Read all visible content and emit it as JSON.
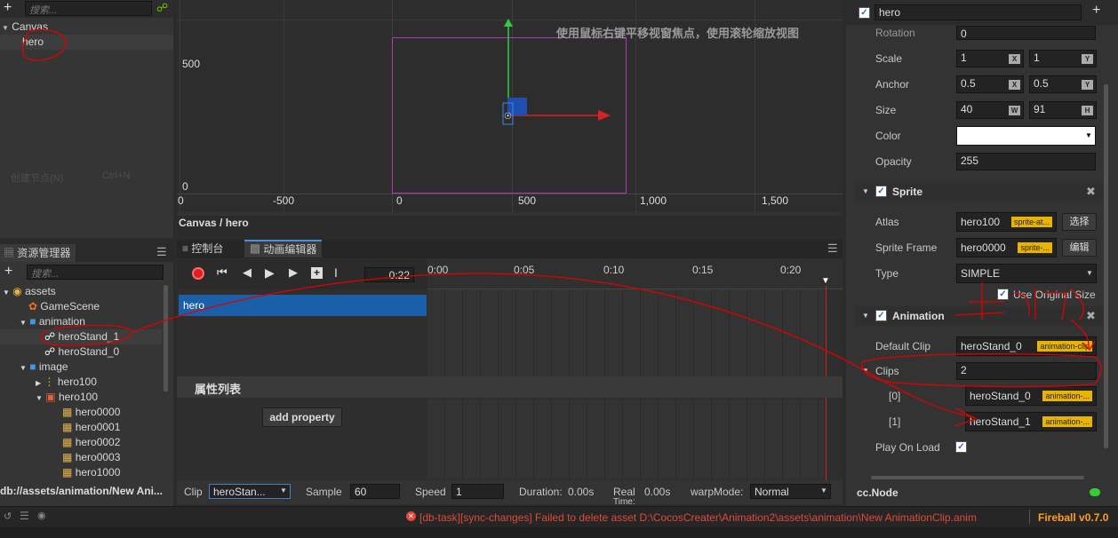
{
  "hierarchy": {
    "search_placeholder": "搜索...",
    "root": "Canvas",
    "child": "hero",
    "faded_menu_label": "创建节点(N)",
    "faded_menu_shortcut": "Ctrl+N"
  },
  "scene": {
    "hint": "使用鼠标右键平移视窗焦点，使用滚轮缩放视图",
    "y_ticks": [
      "500",
      "0"
    ],
    "x_ticks": [
      "0",
      "-500",
      "0",
      "500",
      "1,000",
      "1,500"
    ],
    "breadcrumb": "Canvas / hero"
  },
  "assets": {
    "tab_label": "资源管理器",
    "search_placeholder": "搜索...",
    "items": [
      {
        "label": "assets",
        "icon": "folder-icon"
      },
      {
        "label": "GameScene",
        "icon": "scene-icon"
      },
      {
        "label": "animation",
        "icon": "folder-icon"
      },
      {
        "label": "heroStand_1",
        "icon": "animation-clip-icon"
      },
      {
        "label": "heroStand_0",
        "icon": "animation-clip-icon"
      },
      {
        "label": "image",
        "icon": "folder-icon"
      },
      {
        "label": "hero100",
        "icon": "atlas-icon"
      },
      {
        "label": "hero100",
        "icon": "texture-icon"
      },
      {
        "label": "hero0000",
        "icon": "sprite-frame-icon"
      },
      {
        "label": "hero0001",
        "icon": "sprite-frame-icon"
      },
      {
        "label": "hero0002",
        "icon": "sprite-frame-icon"
      },
      {
        "label": "hero0003",
        "icon": "sprite-frame-icon"
      },
      {
        "label": "hero1000",
        "icon": "sprite-frame-icon"
      }
    ],
    "path": "db://assets/animation/New Ani..."
  },
  "timeline": {
    "tab_console": "控制台",
    "tab_animation": "动画编辑器",
    "time_value": "0:22",
    "ruler": [
      "0:00",
      "0:05",
      "0:10",
      "0:15",
      "0:20"
    ],
    "node_row": "hero",
    "property_list_title": "属性列表",
    "add_property": "add property",
    "clip_label": "Clip",
    "clip_value": "heroStan...",
    "sample_label": "Sample",
    "sample_value": "60",
    "speed_label": "Speed",
    "speed_value": "1",
    "duration_label": "Duration:",
    "duration_value": "0.00s",
    "real_label": "Real",
    "real_sub": "Time:",
    "real_value": "0.00s",
    "warp_label": "warpMode:",
    "warp_value": "Normal"
  },
  "inspector": {
    "node_name": "hero",
    "rotation_label": "Rotation",
    "rotation_value": "0",
    "scale_label": "Scale",
    "scale_x": "1",
    "scale_y": "1",
    "anchor_label": "Anchor",
    "anchor_x": "0.5",
    "anchor_y": "0.5",
    "size_label": "Size",
    "size_w": "40",
    "size_h": "91",
    "color_label": "Color",
    "opacity_label": "Opacity",
    "opacity_value": "255",
    "sprite_title": "Sprite",
    "atlas_label": "Atlas",
    "atlas_value": "hero100",
    "atlas_badge": "sprite-at...",
    "select_btn": "选择",
    "frame_label": "Sprite Frame",
    "frame_value": "hero0000",
    "frame_badge": "sprite-...",
    "edit_btn": "编辑",
    "type_label": "Type",
    "type_value": "SIMPLE",
    "use_original": "Use Original Size",
    "animation_title": "Animation",
    "default_clip_label": "Default Clip",
    "default_clip_value": "heroStand_0",
    "default_clip_badge": "animation-clip",
    "clips_label": "Clips",
    "clips_value": "2",
    "clip0_index": "[0]",
    "clip0_value": "heroStand_0",
    "clip0_badge": "animation-...",
    "clip1_index": "[1]",
    "clip1_value": "heroStand_1",
    "clip1_badge": "animation-...",
    "play_on_load": "Play On Load",
    "component_type": "cc.Node",
    "axis_x": "X",
    "axis_y": "Y",
    "axis_w": "W",
    "axis_h": "H"
  },
  "status": {
    "error": "[db-task][sync-changes] Failed to delete asset D:\\CocosCreater\\Animation2\\assets\\animation\\New AnimationClip.anim",
    "version": "Fireball v0.7.0"
  },
  "colors": {
    "selection_blue": "#1a5fa8",
    "error_red": "#e04a3a",
    "version_orange": "#ff9f1a",
    "badge_yellow": "#e8b400",
    "annotation_red": "#e00000"
  }
}
